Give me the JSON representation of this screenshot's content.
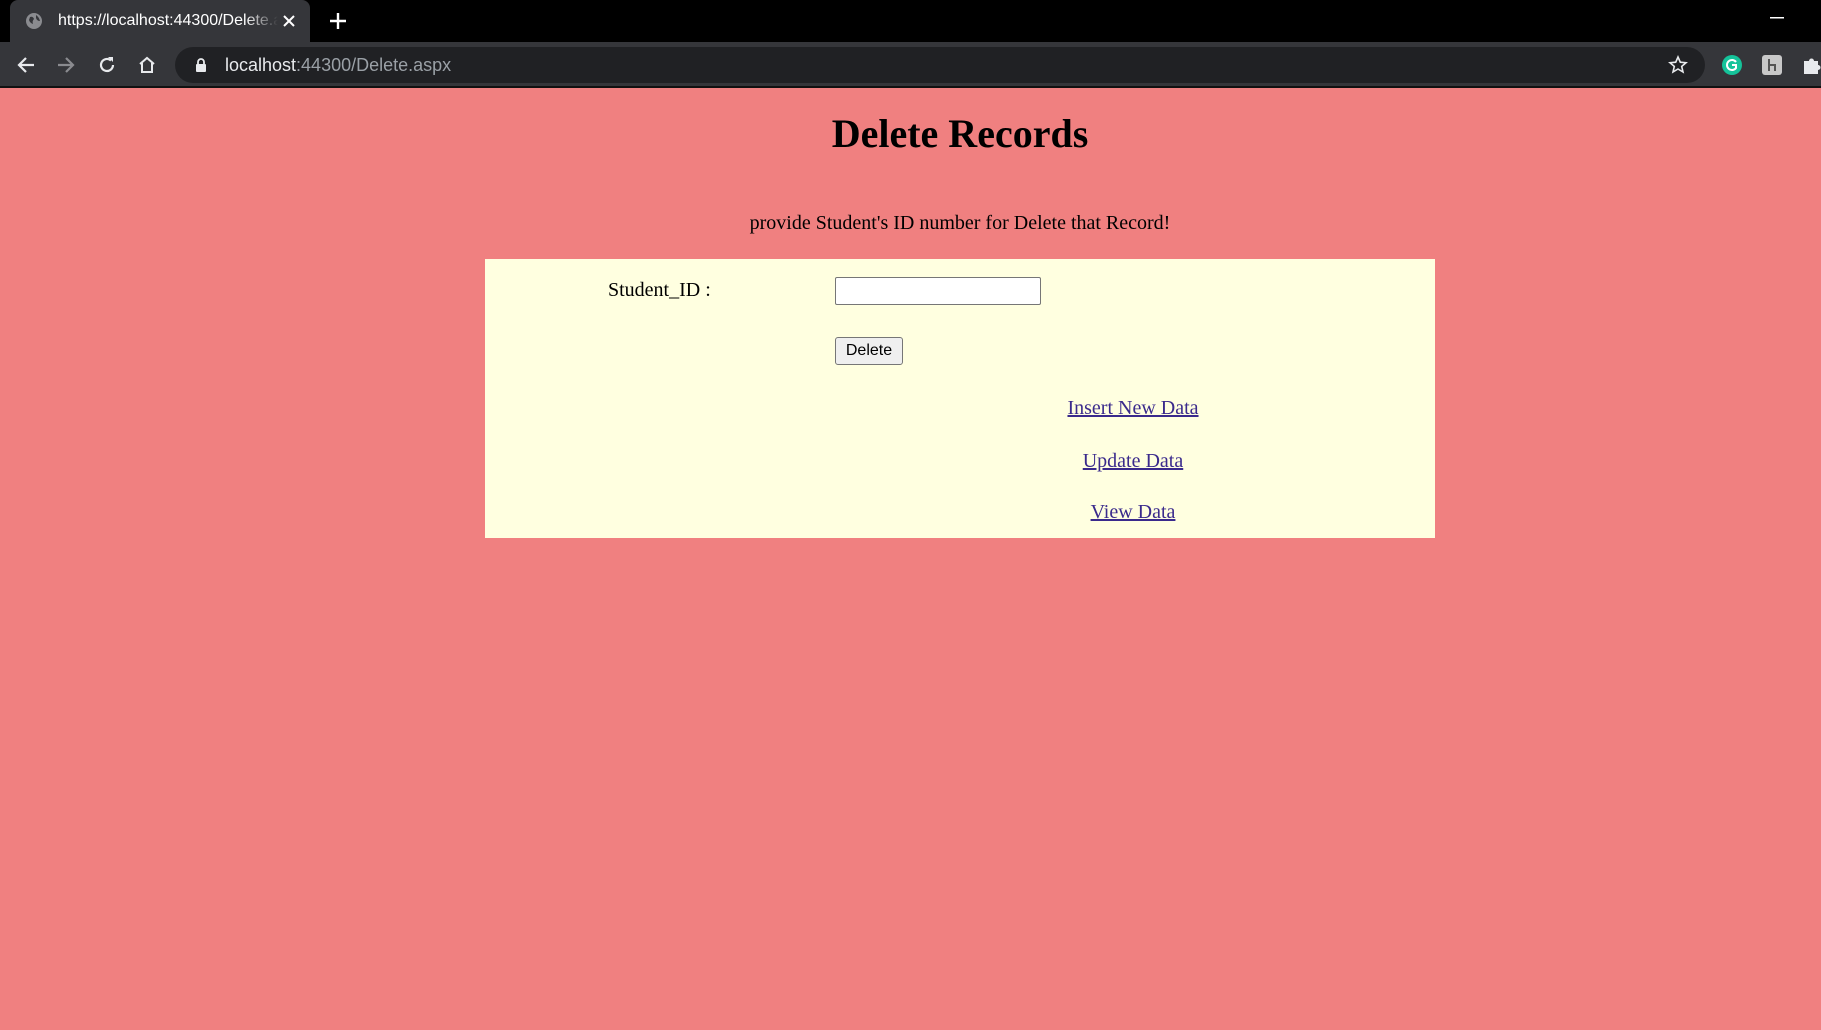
{
  "browser": {
    "tab": {
      "title": "https://localhost:44300/Delete.aspx"
    },
    "address_bar": {
      "host": "localhost",
      "rest": ":44300/Delete.aspx"
    },
    "extensions": [
      "grammarly-icon",
      "extension-h-icon",
      "puzzle-icon"
    ]
  },
  "page": {
    "title": "Delete Records",
    "instructions": "provide Student's ID number for Delete that Record!",
    "form": {
      "student_id_label": "Student_ID :",
      "student_id_value": "",
      "delete_label": "Delete"
    },
    "links": {
      "insert": "Insert New Data",
      "update": "Update Data",
      "view": "View Data"
    }
  },
  "colors": {
    "page_background": "#f08080",
    "panel_background": "#ffffe0",
    "link": "#3a2a8c"
  }
}
